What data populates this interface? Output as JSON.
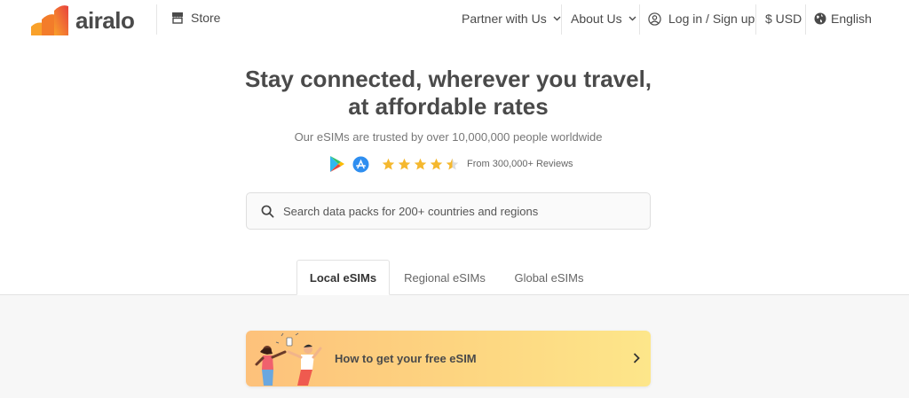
{
  "header": {
    "brand": "airalo",
    "store_label": "Store",
    "partner_label": "Partner with Us",
    "about_label": "About Us",
    "login_label": "Log in / Sign up",
    "currency_label": "$ USD",
    "language_label": "English"
  },
  "hero": {
    "title_line1": "Stay connected, wherever you travel,",
    "title_line2": "at affordable rates",
    "subtitle": "Our eSIMs are trusted by over 10,000,000 people worldwide",
    "reviews_text": "From 300,000+ Reviews",
    "rating": 4.5
  },
  "search": {
    "placeholder": "Search data packs for 200+ countries and regions"
  },
  "tabs": [
    {
      "label": "Local eSIMs",
      "active": true
    },
    {
      "label": "Regional eSIMs",
      "active": false
    },
    {
      "label": "Global eSIMs",
      "active": false
    }
  ],
  "banner": {
    "label": "How to get your free eSIM"
  },
  "colors": {
    "brand_orange": "#f58220",
    "brand_red": "#e8413d",
    "text_dark": "#4a4a4a",
    "star": "#f5b82e",
    "banner_start": "#fdc17b",
    "banner_end": "#fde68a"
  },
  "icons": [
    "logo-icon",
    "store-icon",
    "chevron-down-icon",
    "user-circle-icon",
    "globe-icon",
    "google-play-icon",
    "app-store-icon",
    "star-icon",
    "search-icon",
    "chevron-right-icon"
  ]
}
